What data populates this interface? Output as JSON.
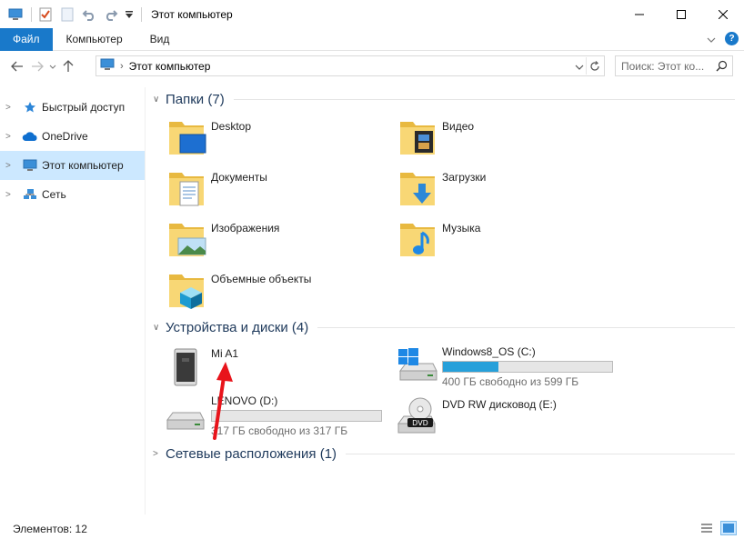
{
  "window": {
    "title": "Этот компьютер"
  },
  "ribbon": {
    "tabs": [
      {
        "label": "Файл",
        "active": true
      },
      {
        "label": "Компьютер"
      },
      {
        "label": "Вид"
      }
    ]
  },
  "address": {
    "path": "Этот компьютер"
  },
  "search": {
    "placeholder": "Поиск: Этот ко..."
  },
  "nav": {
    "items": [
      {
        "label": "Быстрый доступ",
        "icon": "star-icon"
      },
      {
        "label": "OneDrive",
        "icon": "cloud-icon"
      },
      {
        "label": "Этот компьютер",
        "icon": "computer-icon",
        "selected": true
      },
      {
        "label": "Сеть",
        "icon": "network-icon"
      }
    ]
  },
  "groups": {
    "folders": {
      "title": "Папки (7)",
      "items": [
        {
          "name": "Desktop",
          "icon": "desktop-folder-icon"
        },
        {
          "name": "Видео",
          "icon": "video-folder-icon"
        },
        {
          "name": "Документы",
          "icon": "documents-folder-icon"
        },
        {
          "name": "Загрузки",
          "icon": "downloads-folder-icon"
        },
        {
          "name": "Изображения",
          "icon": "pictures-folder-icon"
        },
        {
          "name": "Музыка",
          "icon": "music-folder-icon"
        },
        {
          "name": "Объемные объекты",
          "icon": "3d-objects-folder-icon"
        }
      ]
    },
    "devices": {
      "title": "Устройства и диски (4)",
      "items": [
        {
          "name": "Mi A1",
          "icon": "portable-device-icon"
        },
        {
          "name": "Windows8_OS (C:)",
          "icon": "system-drive-icon",
          "free": "400 ГБ свободно из 599 ГБ",
          "used_fraction": 0.33
        },
        {
          "name": "LENOVO (D:)",
          "icon": "hard-drive-icon",
          "free": "317 ГБ свободно из 317 ГБ",
          "used_fraction": 0.0
        },
        {
          "name": "DVD RW дисковод (E:)",
          "icon": "dvd-drive-icon"
        }
      ]
    },
    "network": {
      "title": "Сетевые расположения (1)"
    }
  },
  "status": {
    "count": "Элементов: 12"
  },
  "colors": {
    "accent": "#1979ca",
    "selection": "#cce8ff",
    "drive_bar": "#26a0da",
    "annotation_arrow": "#e8141b"
  }
}
